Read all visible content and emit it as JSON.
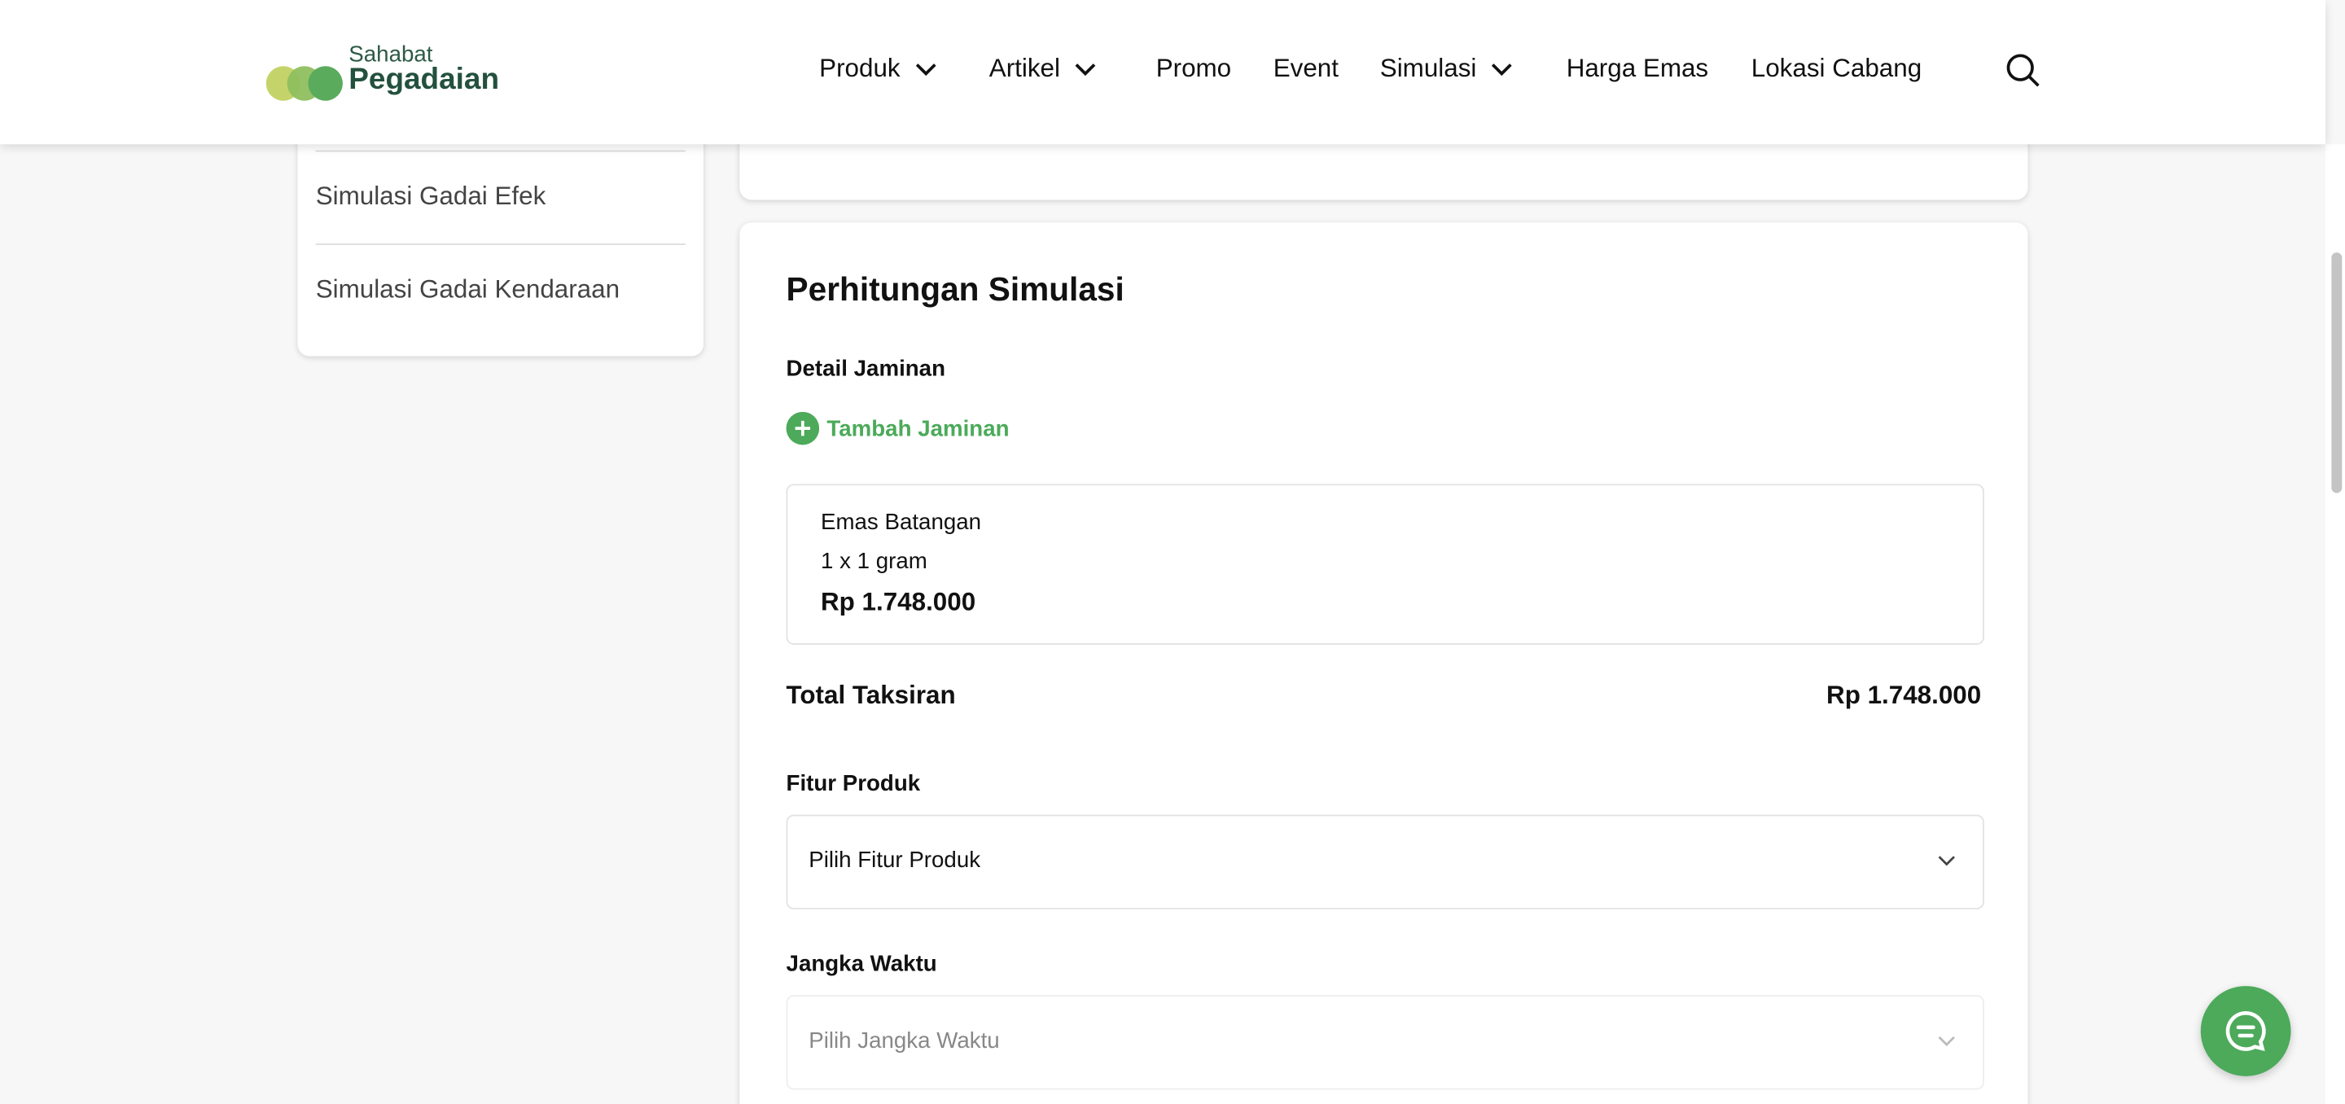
{
  "header": {
    "logo": {
      "line1": "Sahabat",
      "line2": "Pegadaian"
    },
    "nav": [
      {
        "label": "Produk",
        "dropdown": true
      },
      {
        "label": "Artikel",
        "dropdown": true
      },
      {
        "label": "Promo",
        "dropdown": false
      },
      {
        "label": "Event",
        "dropdown": false
      },
      {
        "label": "Simulasi",
        "dropdown": true
      },
      {
        "label": "Harga Emas",
        "dropdown": false
      },
      {
        "label": "Lokasi Cabang",
        "dropdown": false
      }
    ]
  },
  "sidebar": {
    "items": [
      "Simulasi Gadai Efek",
      "Simulasi Gadai Kendaraan"
    ]
  },
  "main": {
    "title": "Perhitungan Simulasi",
    "detail_label": "Detail Jaminan",
    "add_label": "Tambah Jaminan",
    "item": {
      "name": "Emas Batangan",
      "qty": "1 x 1 gram",
      "price": "Rp 1.748.000"
    },
    "total_label": "Total Taksiran",
    "total_value": "Rp 1.748.000",
    "fitur_label": "Fitur Produk",
    "fitur_placeholder": "Pilih Fitur Produk",
    "jangka_label": "Jangka Waktu",
    "jangka_placeholder": "Pilih Jangka Waktu"
  },
  "colors": {
    "accent": "#4caa5a",
    "brand_dark": "#23513e"
  }
}
